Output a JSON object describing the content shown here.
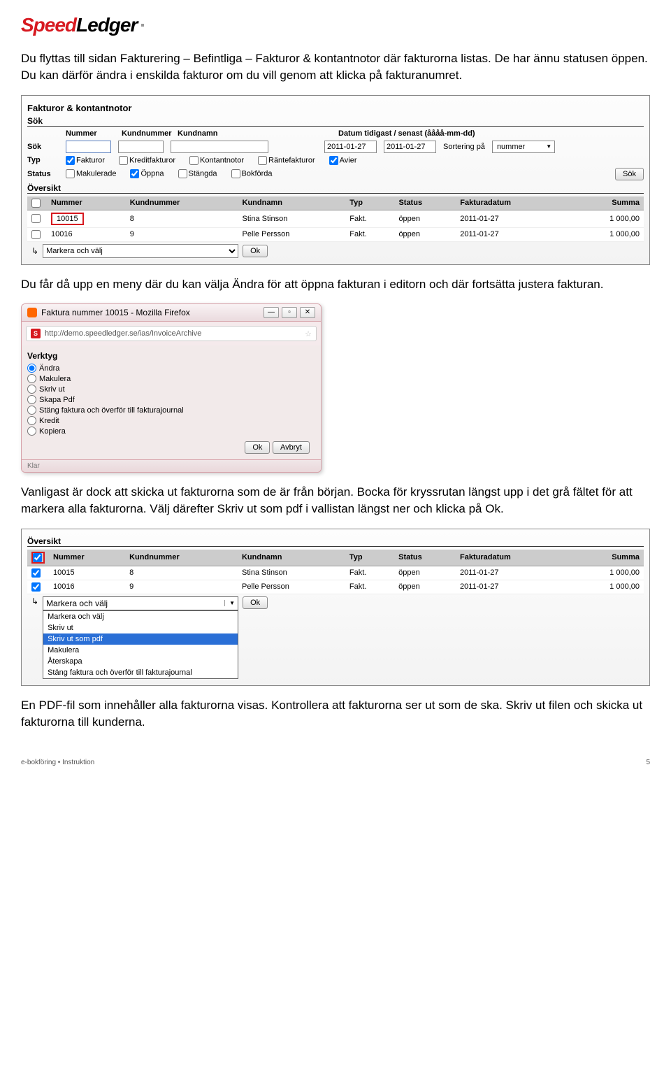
{
  "logo": {
    "speed": "Speed",
    "ledger": "Ledger"
  },
  "para1": "Du flyttas till sidan Fakturering – Befintliga – Fakturor & kontantnotor där fakturorna listas. De har ännu statusen öppen. Du kan därför ändra i enskilda fakturor om du vill genom att klicka på fakturanumret.",
  "panel1": {
    "title": "Fakturor & kontantnotor",
    "sok": "Sök",
    "cols": {
      "nummer": "Nummer",
      "kundnummer": "Kundnummer",
      "kundnamn": "Kundnamn",
      "datum": "Datum tidigast / senast (åååå-mm-dd)"
    },
    "sok_label": "Sök",
    "date1": "2011-01-27",
    "date2": "2011-01-27",
    "sort_label": "Sortering på",
    "sort_val": "nummer",
    "typ": "Typ",
    "typ_opts": [
      "Fakturor",
      "Kreditfakturor",
      "Kontantnotor",
      "Räntefakturor",
      "Avier"
    ],
    "status": "Status",
    "status_opts": [
      "Makulerade",
      "Öppna",
      "Stängda",
      "Bokförda"
    ],
    "sok_btn": "Sök",
    "oversikt": "Översikt",
    "th": [
      "",
      "Nummer",
      "Kundnummer",
      "Kundnamn",
      "Typ",
      "Status",
      "Fakturadatum",
      "Summa"
    ],
    "rows": [
      {
        "num": "10015",
        "k": "8",
        "namn": "Stina Stinson",
        "typ": "Fakt.",
        "status": "öppen",
        "datum": "2011-01-27",
        "summa": "1 000,00",
        "hl": true
      },
      {
        "num": "10016",
        "k": "9",
        "namn": "Pelle Persson",
        "typ": "Fakt.",
        "status": "öppen",
        "datum": "2011-01-27",
        "summa": "1 000,00",
        "hl": false
      }
    ],
    "markera": "Markera och välj",
    "ok": "Ok"
  },
  "para2": "Du får då upp en meny där du kan välja Ändra för att öppna fakturan i editorn och där fortsätta justera fakturan.",
  "ff": {
    "title": "Faktura nummer 10015 - Mozilla Firefox",
    "url": "http://demo.speedledger.se/ias/InvoiceArchive",
    "verktyg": "Verktyg",
    "opts": [
      "Ändra",
      "Makulera",
      "Skriv ut",
      "Skapa Pdf",
      "Stäng faktura och överför till fakturajournal",
      "Kredit",
      "Kopiera"
    ],
    "ok": "Ok",
    "avbryt": "Avbryt",
    "status": "Klar"
  },
  "para3": "Vanligast är dock att skicka ut fakturorna som de är från början. Bocka för kryssrutan längst upp i det grå fältet för att markera alla fakturorna. Välj därefter Skriv ut som pdf i vallistan längst ner och klicka på Ok.",
  "panel2": {
    "oversikt": "Översikt",
    "th": [
      "",
      "Nummer",
      "Kundnummer",
      "Kundnamn",
      "Typ",
      "Status",
      "Fakturadatum",
      "Summa"
    ],
    "rows": [
      {
        "num": "10015",
        "k": "8",
        "namn": "Stina Stinson",
        "typ": "Fakt.",
        "status": "öppen",
        "datum": "2011-01-27",
        "summa": "1 000,00"
      },
      {
        "num": "10016",
        "k": "9",
        "namn": "Pelle Persson",
        "typ": "Fakt.",
        "status": "öppen",
        "datum": "2011-01-27",
        "summa": "1 000,00"
      }
    ],
    "markera": "Markera och välj",
    "ok": "Ok",
    "ddopts": [
      "Markera och välj",
      "Skriv ut",
      "Skriv ut som pdf",
      "Makulera",
      "Återskapa",
      "Stäng faktura och överför till fakturajournal"
    ]
  },
  "para4": "En PDF-fil som innehåller alla fakturorna visas. Kontrollera att fakturorna ser ut som de ska. Skriv ut filen och skicka ut fakturorna till kunderna.",
  "footer": {
    "left": "e-bokföring  •  Instruktion",
    "right": "5"
  }
}
